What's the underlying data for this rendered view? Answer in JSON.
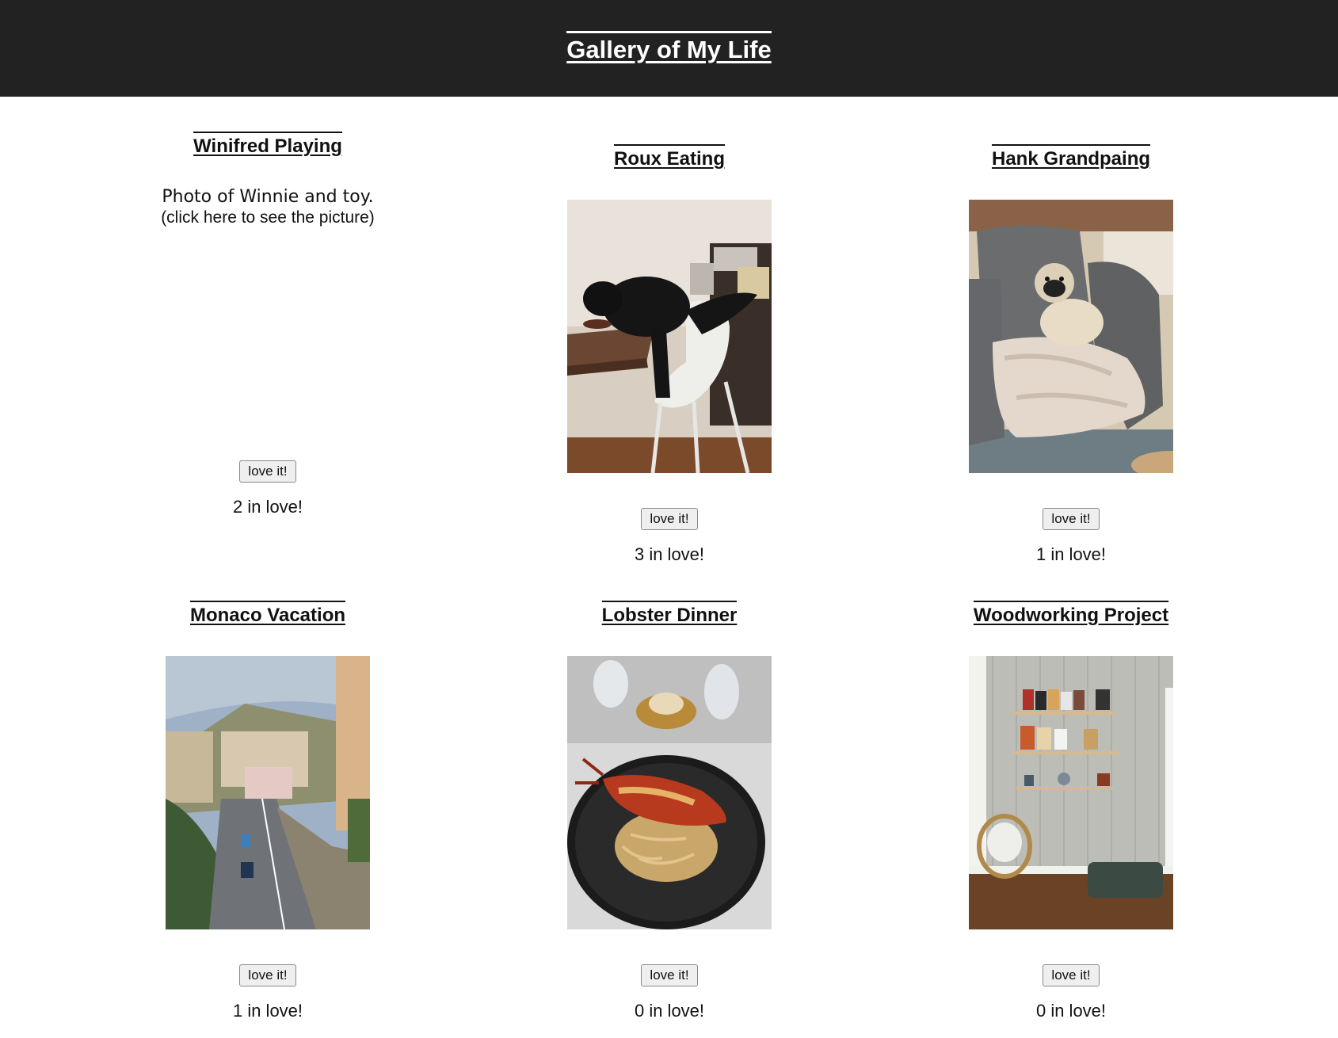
{
  "header": {
    "title": "Gallery of My Life"
  },
  "button_label": "love it!",
  "cards": [
    {
      "title": "Winifred Playing",
      "alt_line1": "Photo of Winnie and toy.",
      "alt_line2": "(click here to see the picture)",
      "count_text": "2 in love!",
      "image_loaded": false
    },
    {
      "title": "Roux Eating",
      "count_text": "3 in love!",
      "image": "black-cat-eating-on-chair",
      "image_loaded": true
    },
    {
      "title": "Hank Grandpaing",
      "count_text": "1 in love!",
      "image": "pug-on-gray-armchair",
      "image_loaded": true
    },
    {
      "title": "Monaco Vacation",
      "count_text": "1 in love!",
      "image": "monaco-road-and-buildings",
      "image_loaded": true
    },
    {
      "title": "Lobster Dinner",
      "count_text": "0 in love!",
      "image": "lobster-pasta-plate",
      "image_loaded": true
    },
    {
      "title": "Woodworking Project",
      "count_text": "0 in love!",
      "image": "wall-shelves-with-records",
      "image_loaded": true
    }
  ]
}
